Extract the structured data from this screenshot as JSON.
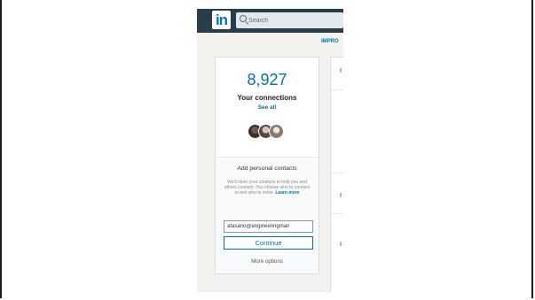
{
  "header": {
    "logo_text": "in",
    "search_placeholder": "Search"
  },
  "banner": {
    "improve_label": "IMPRO"
  },
  "connections_card": {
    "count": "8,927",
    "label": "Your connections",
    "see_all": "See all"
  },
  "contacts": {
    "title": "Add personal contacts",
    "description": "We'll store your contacts to help you and others connect. You choose who to connect to and who to invite.",
    "learn_more": "Learn more",
    "email_value": "afasano@engineeringman",
    "continue_label": "Continue",
    "more_options": "More options"
  },
  "colors": {
    "nav_bg": "#283e4a",
    "brand_blue": "#0073b1",
    "page_bg": "#f3f2ef"
  }
}
